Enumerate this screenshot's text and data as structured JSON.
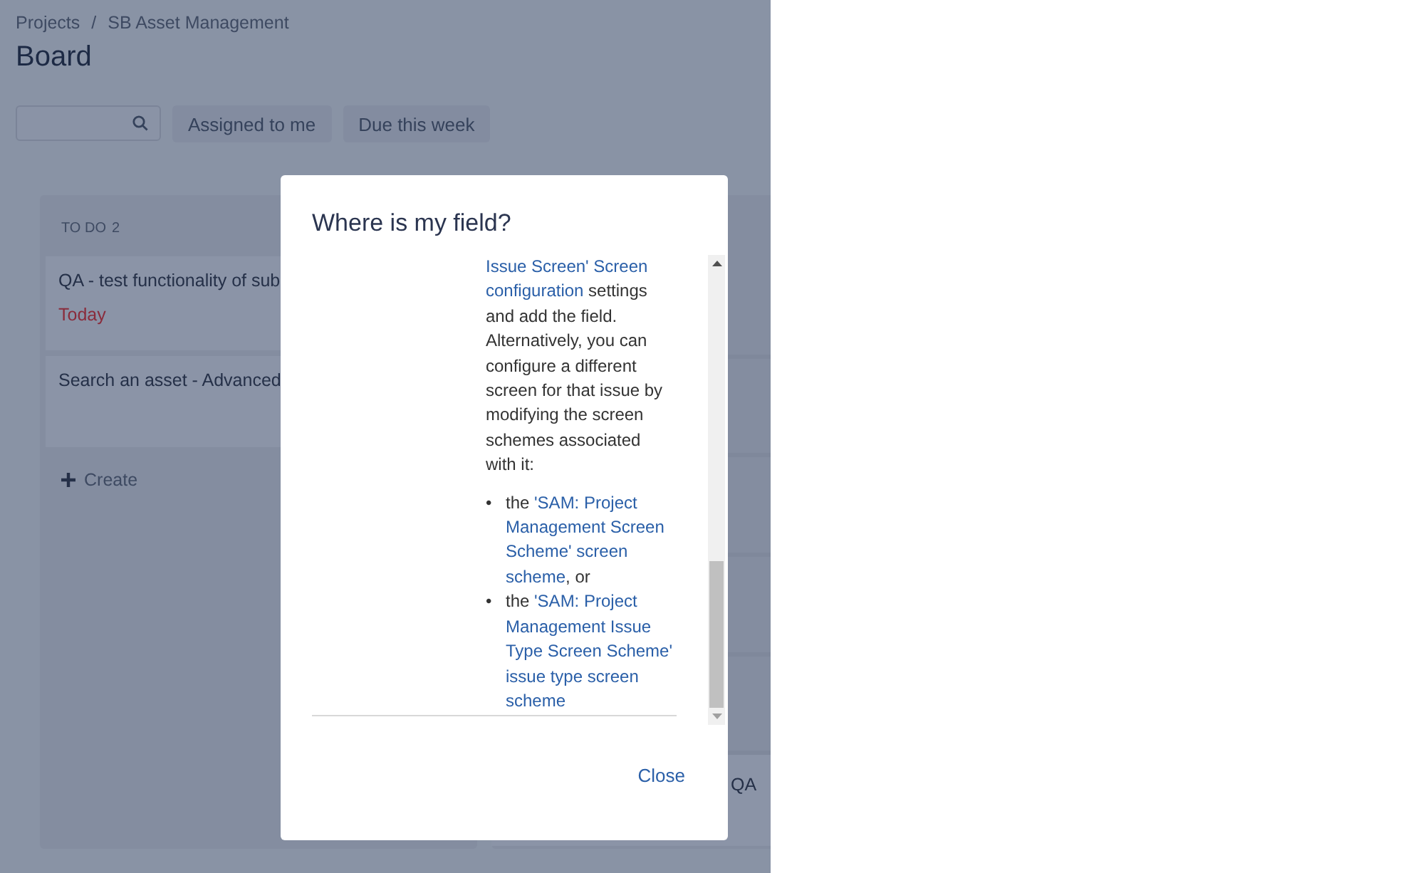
{
  "breadcrumbs": [
    "Projects",
    "SB Asset Management"
  ],
  "breadcrumb_separator": "/",
  "title": "Board",
  "filters": [
    "Assigned to me",
    "Due this week"
  ],
  "columns": [
    {
      "title": "TO DO",
      "count": "2",
      "cards": [
        {
          "title": "QA - test functionality of sub",
          "due": "Today"
        },
        {
          "title": "Search an asset - Advanced"
        }
      ],
      "create": "Create"
    },
    {
      "cards": [
        {
          "title": "QA"
        }
      ]
    }
  ],
  "dialog": {
    "title": "Where is my field?",
    "paragraph": [
      [
        {
          "text": "Issue Screen' Screen",
          "link": true
        }
      ],
      [
        {
          "text": "configuration",
          "link": true
        },
        {
          "text": " settings",
          "link": false
        }
      ],
      [
        {
          "text": "and add the field.",
          "link": false
        }
      ],
      [
        {
          "text": "Alternatively, you can",
          "link": false
        }
      ],
      [
        {
          "text": "configure a different",
          "link": false
        }
      ],
      [
        {
          "text": "screen for that issue by",
          "link": false
        }
      ],
      [
        {
          "text": "modifying the screen",
          "link": false
        }
      ],
      [
        {
          "text": "schemes associated",
          "link": false
        }
      ],
      [
        {
          "text": "with it:",
          "link": false
        }
      ]
    ],
    "bullets": [
      {
        "marker": "•",
        "lines": [
          [
            {
              "text": "the ",
              "link": false
            },
            {
              "text": "'SAM: Project",
              "link": true
            }
          ],
          [
            {
              "text": "Management Screen",
              "link": true
            }
          ],
          [
            {
              "text": "Scheme' screen",
              "link": true
            }
          ],
          [
            {
              "text": "scheme",
              "link": true
            },
            {
              "text": ", or",
              "link": false
            }
          ]
        ]
      },
      {
        "marker": "•",
        "lines": [
          [
            {
              "text": "the ",
              "link": false
            },
            {
              "text": "'SAM: Project",
              "link": true
            }
          ],
          [
            {
              "text": "Management Issue",
              "link": true
            }
          ],
          [
            {
              "text": "Type Screen Scheme'",
              "link": true
            }
          ],
          [
            {
              "text": "issue type screen",
              "link": true
            }
          ],
          [
            {
              "text": "scheme",
              "link": true
            }
          ]
        ]
      }
    ],
    "close": "Close"
  }
}
